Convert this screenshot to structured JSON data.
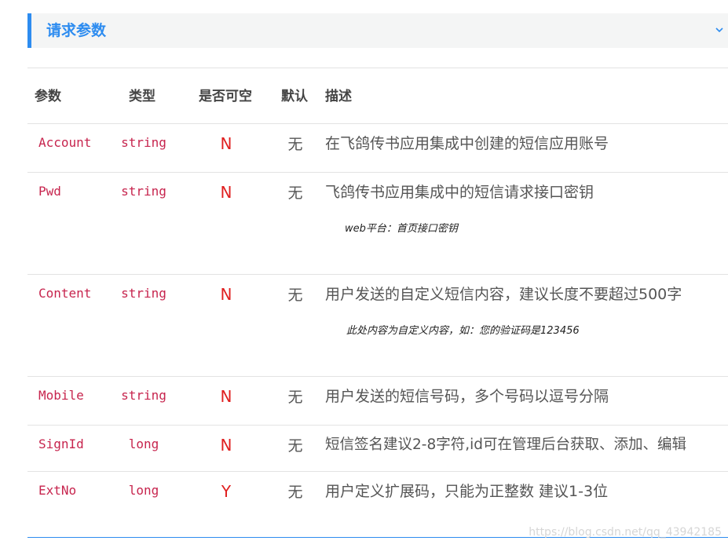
{
  "section": {
    "title": "请求参数"
  },
  "headers": {
    "param": "参数",
    "type": "类型",
    "nullable": "是否可空",
    "default": "默认",
    "desc": "描述"
  },
  "rows": [
    {
      "param": "Account",
      "type": "string",
      "nullable": "N",
      "default": "无",
      "desc": "在飞鸽传书应用集成中创建的短信应用账号",
      "note": ""
    },
    {
      "param": "Pwd",
      "type": "string",
      "nullable": "N",
      "default": "无",
      "desc": "飞鸽传书应用集成中的短信请求接口密钥",
      "note": "web平台：首页接口密钥"
    },
    {
      "param": "Content",
      "type": "string",
      "nullable": "N",
      "default": "无",
      "desc": "用户发送的自定义短信内容，建议长度不要超过500字",
      "note": "此处内容为自定义内容，如：您的验证码是123456"
    },
    {
      "param": "Mobile",
      "type": "string",
      "nullable": "N",
      "default": "无",
      "desc": "用户发送的短信号码，多个号码以逗号分隔",
      "note": ""
    },
    {
      "param": "SignId",
      "type": "long",
      "nullable": "N",
      "default": "无",
      "desc": "短信签名建议2-8字符,id可在管理后台获取、添加、编辑",
      "note": ""
    },
    {
      "param": "ExtNo",
      "type": "long",
      "nullable": "Y",
      "default": "无",
      "desc": "用户定义扩展码，只能为正整数 建议1-3位",
      "note": ""
    }
  ],
  "watermark": "https://blog.csdn.net/qq_43942185",
  "colors": {
    "accent": "#2d8cf0",
    "code": "#c7254e",
    "flag": "#e02020"
  }
}
